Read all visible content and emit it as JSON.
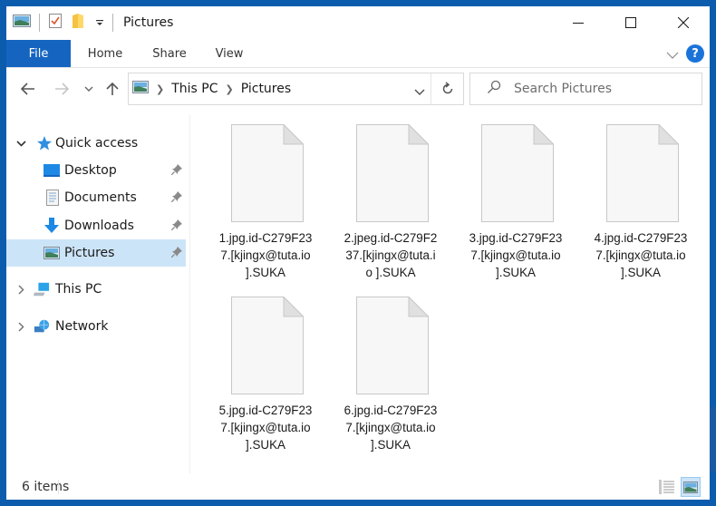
{
  "window": {
    "title": "Pictures",
    "controls": {
      "minimize": "minimize",
      "maximize": "maximize",
      "close": "close"
    }
  },
  "quick_access_toolbar": {
    "icons": [
      "pictures-icon",
      "properties-icon",
      "new-folder-icon",
      "customize-dropdown-icon"
    ]
  },
  "ribbon": {
    "tabs": [
      {
        "label": "File",
        "active": true
      },
      {
        "label": "Home"
      },
      {
        "label": "Share"
      },
      {
        "label": "View"
      }
    ],
    "help_label": "?"
  },
  "address_bar": {
    "breadcrumbs": [
      "This PC",
      "Pictures"
    ]
  },
  "search": {
    "placeholder": "Search Pictures"
  },
  "sidebar": {
    "quick_access": {
      "label": "Quick access"
    },
    "items": [
      {
        "label": "Desktop",
        "pinned": true
      },
      {
        "label": "Documents",
        "pinned": true
      },
      {
        "label": "Downloads",
        "pinned": true
      },
      {
        "label": "Pictures",
        "pinned": true,
        "selected": true
      }
    ],
    "this_pc": {
      "label": "This PC"
    },
    "network": {
      "label": "Network"
    }
  },
  "files": [
    {
      "name": "1.jpg.id-C279F23\n7.[kjingx@tuta.io\n].SUKA"
    },
    {
      "name": "2.jpeg.id-C279F2\n37.[kjingx@tuta.i\no ].SUKA"
    },
    {
      "name": "3.jpg.id-C279F23\n7.[kjingx@tuta.io\n].SUKA"
    },
    {
      "name": "4.jpg.id-C279F23\n7.[kjingx@tuta.io\n].SUKA"
    },
    {
      "name": "5.jpg.id-C279F23\n7.[kjingx@tuta.io\n].SUKA"
    },
    {
      "name": "6.jpg.id-C279F23\n7.[kjingx@tuta.io\n].SUKA"
    }
  ],
  "status_bar": {
    "item_count": "6 items",
    "views": [
      {
        "name": "details-view",
        "active": false
      },
      {
        "name": "large-icons-view",
        "active": true
      }
    ]
  },
  "colors": {
    "frame": "#0b5cad",
    "file_tab": "#1565c0",
    "selection": "#cce4f7",
    "help": "#1a73d9"
  }
}
